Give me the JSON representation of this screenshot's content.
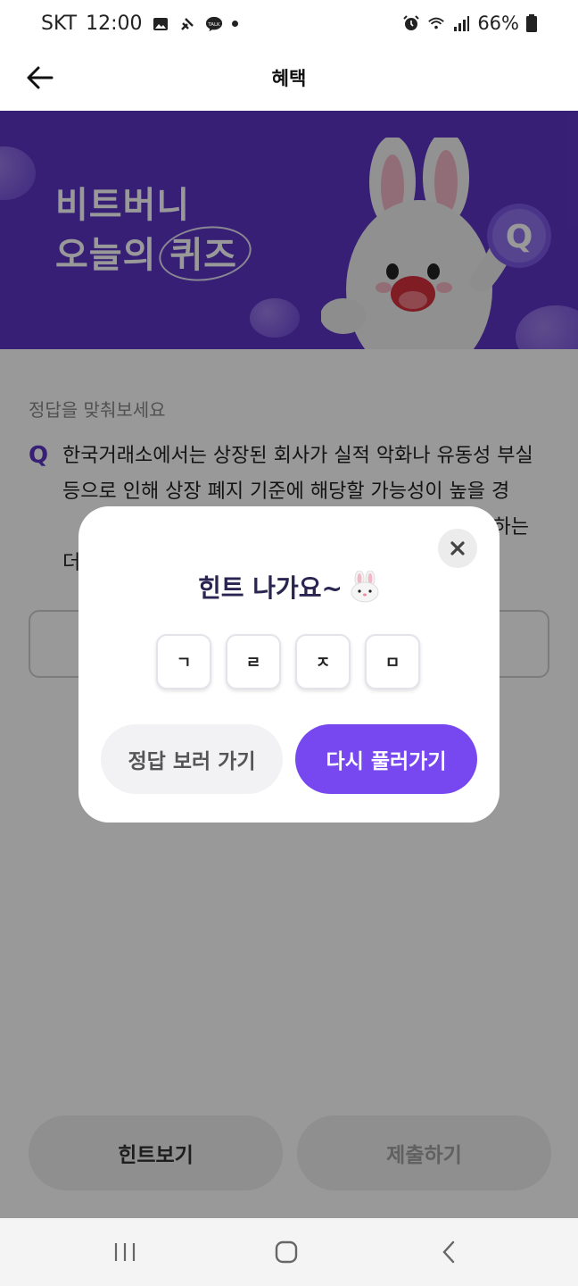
{
  "status_bar": {
    "carrier": "SKT",
    "time": "12:00",
    "battery": "66%"
  },
  "header": {
    "title": "혜택"
  },
  "banner": {
    "line1": "비트버니",
    "line2_prefix": "오늘의 ",
    "line2_highlight": "퀴즈",
    "badge_letter": "Q"
  },
  "quiz": {
    "instruction": "정답을 맞춰보세요",
    "q_label": "Q",
    "question_visible": "한국거래소에서는 상장된 회사가 실적 악화나 유동성 부실 등으로 인해 상장 폐지 기준에 해당할 가능성이 높을 경",
    "line3_tail": "하는",
    "line4_head": "더"
  },
  "bottom_buttons": {
    "hint": "힌트보기",
    "submit": "제출하기"
  },
  "modal": {
    "title": "힌트 나가요~",
    "tiles": [
      "ㄱ",
      "ㄹ",
      "ㅈ",
      "ㅁ"
    ],
    "secondary_button": "정답 보러 가기",
    "primary_button": "다시 풀러가기"
  },
  "colors": {
    "brand_purple": "#5b35c4",
    "button_purple": "#7747f0",
    "dim_overlay": "rgba(0,0,0,0.40)"
  }
}
